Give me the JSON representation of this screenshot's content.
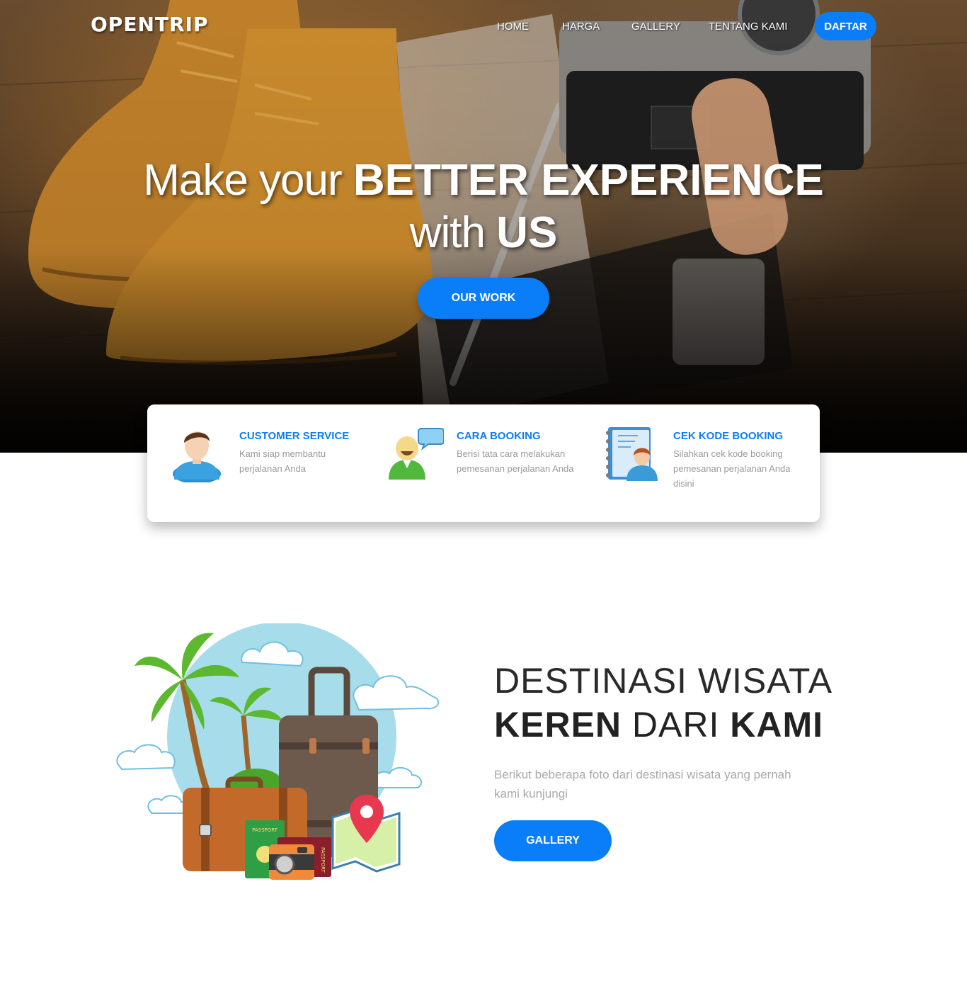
{
  "brand": "OPENTRIP",
  "nav": {
    "home": "HOME",
    "harga": "HARGA",
    "gallery": "GALLERY",
    "tentang": "TENTANG KAMI",
    "daftar": "DAFTAR"
  },
  "hero": {
    "line1_light": "Make your ",
    "line1_bold": "BETTER EXPERIENCE",
    "line2_light": "with ",
    "line2_bold": "US",
    "button": "OUR WORK"
  },
  "info": [
    {
      "icon": "customer-service-icon",
      "title": "CUSTOMER SERVICE",
      "desc": "Kami siap membantu perjalanan Anda"
    },
    {
      "icon": "cara-booking-icon",
      "title": "CARA BOOKING",
      "desc": "Berisi tata cara melakukan pemesanan perjalanan Anda"
    },
    {
      "icon": "cek-kode-booking-icon",
      "title": "CEK KODE BOOKING",
      "desc": "Silahkan cek kode booking pemesanan perjalanan Anda disini"
    }
  ],
  "destination": {
    "title_line1": "DESTINASI WISATA",
    "title_bold1": "KEREN",
    "title_mid": " DARI ",
    "title_bold2": "KAMI",
    "desc": "Berikut beberapa foto dari destinasi wisata yang pernah kami kunjungi",
    "button": "GALLERY",
    "illustration_passport_1": "PASSPORT",
    "illustration_passport_2": "PASSPORT"
  },
  "colors": {
    "accent": "#0a7df8",
    "text_muted": "#9a9a9a"
  }
}
